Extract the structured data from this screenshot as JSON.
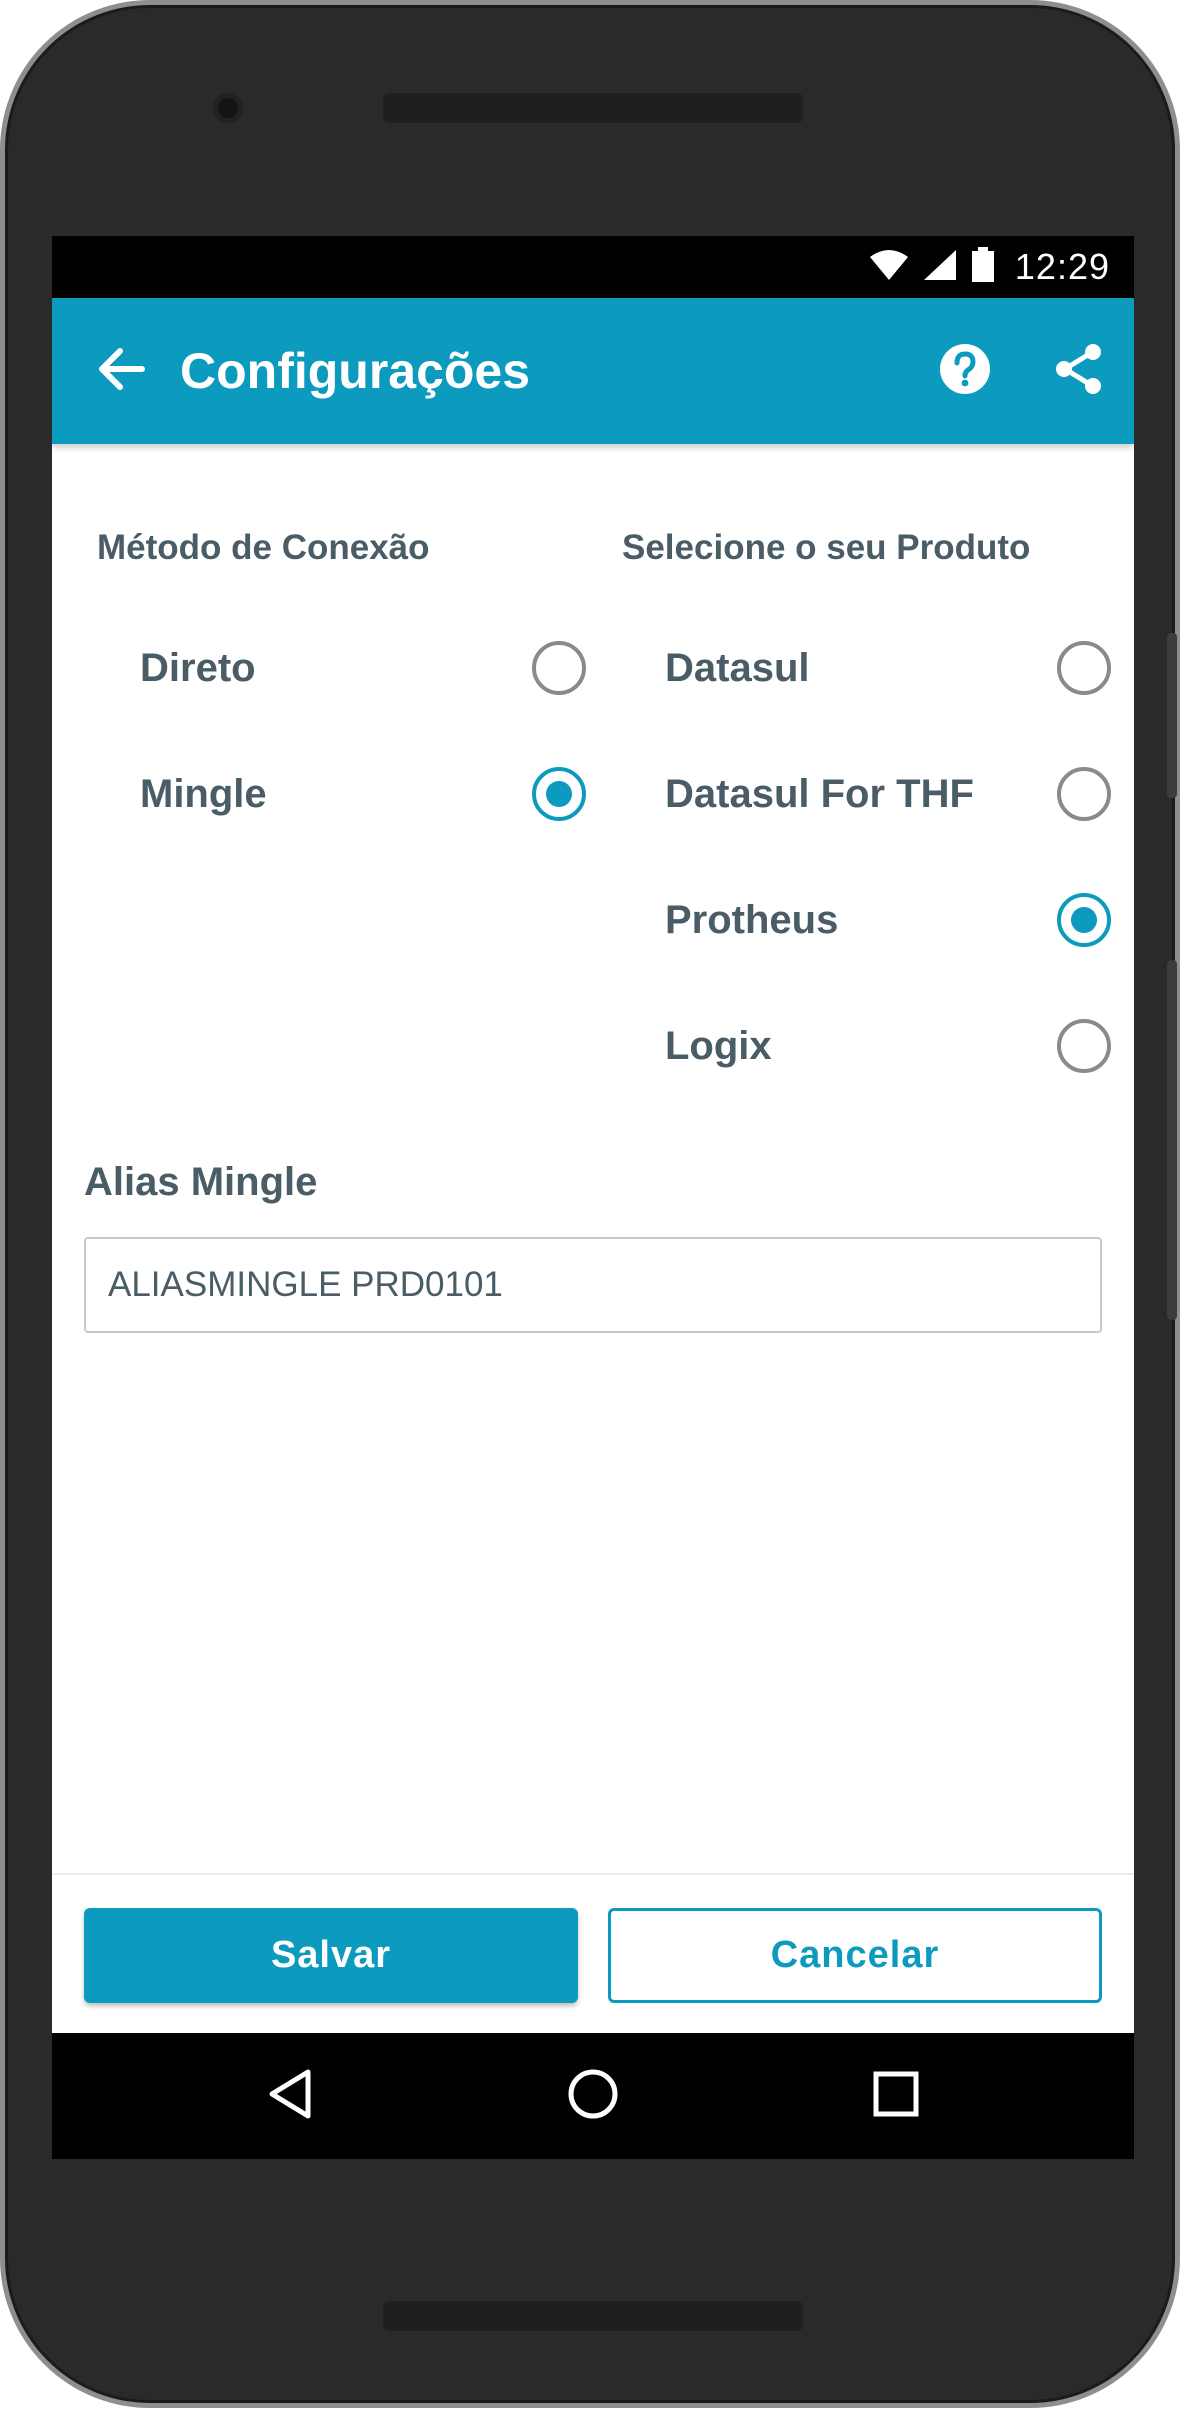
{
  "statusbar": {
    "time": "12:29"
  },
  "appbar": {
    "title": "Configurações"
  },
  "connection": {
    "title": "Método de Conexão",
    "options": [
      {
        "label": "Direto",
        "selected": false
      },
      {
        "label": "Mingle",
        "selected": true
      }
    ]
  },
  "product": {
    "title": "Selecione o seu Produto",
    "options": [
      {
        "label": "Datasul",
        "selected": false
      },
      {
        "label": "Datasul For THF",
        "selected": false
      },
      {
        "label": "Protheus",
        "selected": true
      },
      {
        "label": "Logix",
        "selected": false
      }
    ]
  },
  "alias": {
    "label": "Alias Mingle",
    "value": "ALIASMINGLE PRD0101"
  },
  "actions": {
    "save_label": "Salvar",
    "cancel_label": "Cancelar"
  },
  "colors": {
    "accent": "#0c9abe",
    "text": "#4a5c66",
    "frame": "#2a2a2a"
  },
  "icons": [
    "back-arrow-icon",
    "help-icon",
    "share-icon",
    "wifi-icon",
    "signal-icon",
    "battery-icon",
    "nav-back-icon",
    "nav-home-icon",
    "nav-recents-icon"
  ]
}
